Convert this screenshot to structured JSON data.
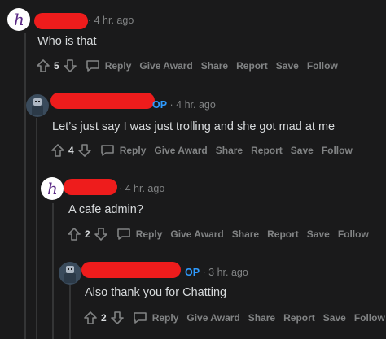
{
  "comments": [
    {
      "time": "· 4 hr. ago",
      "text": "Who is that",
      "score": "5",
      "op": ""
    },
    {
      "time": "· 4 hr. ago",
      "text": "Let’s just say I was just trolling and she got mad at me",
      "score": "4",
      "op": "OP"
    },
    {
      "time": "· 4 hr. ago",
      "text": "A cafe admin?",
      "score": "2",
      "op": ""
    },
    {
      "time": "· 3 hr. ago",
      "text": "Also thank you for Chatting",
      "score": "2",
      "op": "OP"
    }
  ],
  "actions": {
    "reply": "Reply",
    "give_award": "Give Award",
    "share": "Share",
    "report": "Report",
    "save": "Save",
    "follow": "Follow"
  },
  "colors": {
    "background": "#1a1a1b",
    "redaction": "#ee1c1c",
    "op_badge": "#2f9bff",
    "muted": "#818384"
  },
  "icons": [
    "h-logo-avatar",
    "user-avatar",
    "upvote-icon",
    "downvote-icon",
    "reply-icon"
  ]
}
